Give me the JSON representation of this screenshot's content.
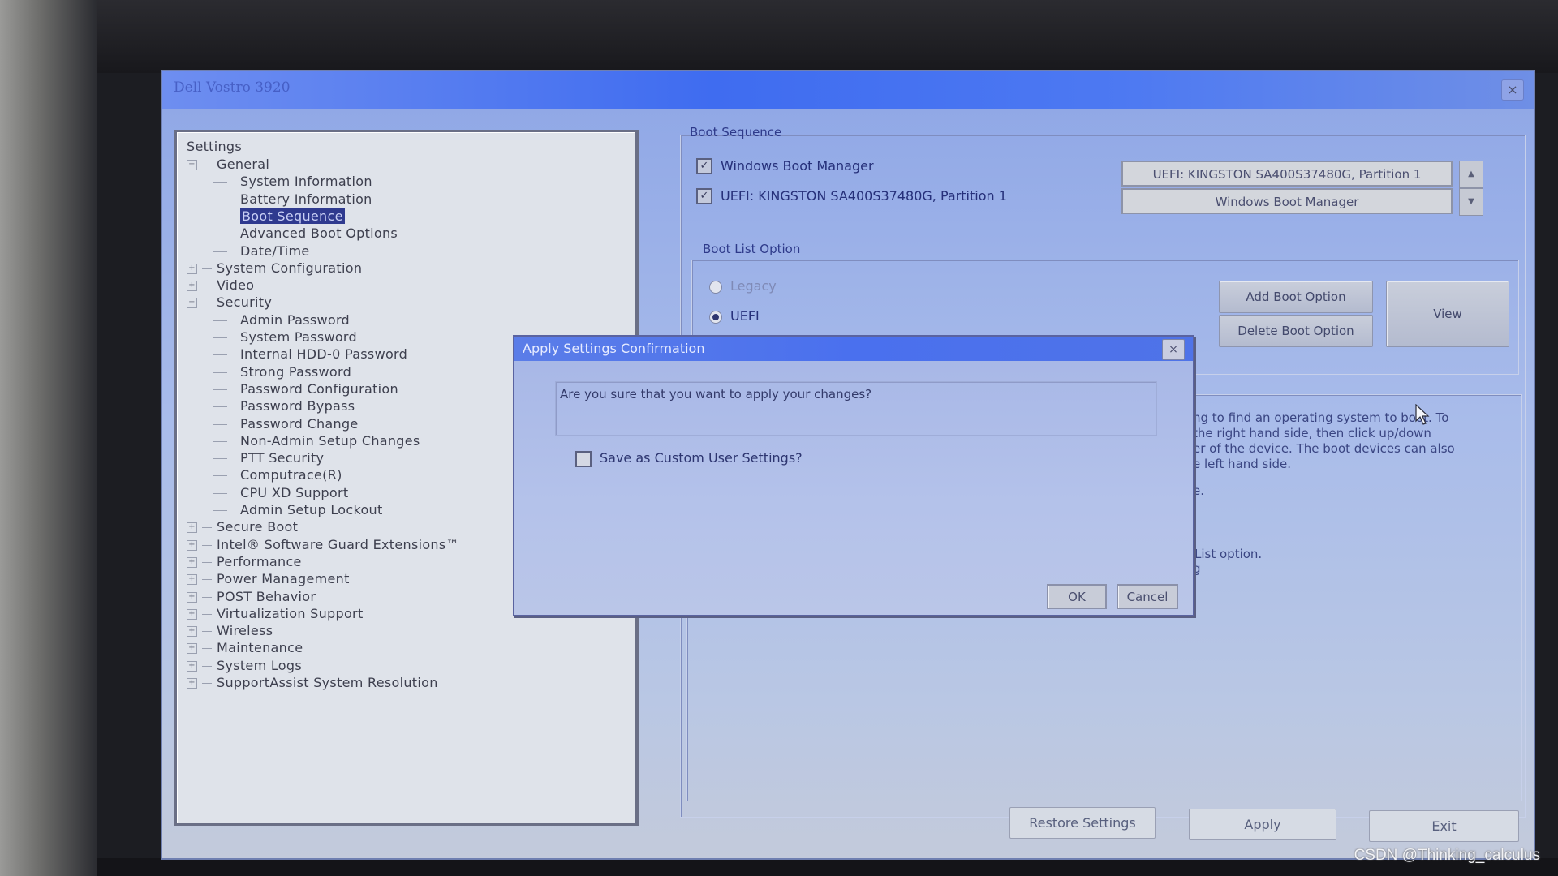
{
  "window": {
    "title": "Dell Vostro 3920",
    "close_icon": "×"
  },
  "tree": {
    "root": "Settings",
    "nodes": [
      {
        "label": "General",
        "level": 1,
        "expander": "−"
      },
      {
        "label": "System Information",
        "level": 2
      },
      {
        "label": "Battery Information",
        "level": 2
      },
      {
        "label": "Boot Sequence",
        "level": 2,
        "selected": true
      },
      {
        "label": "Advanced Boot Options",
        "level": 2
      },
      {
        "label": "Date/Time",
        "level": 2
      },
      {
        "label": "System Configuration",
        "level": 1,
        "expander": "+"
      },
      {
        "label": "Video",
        "level": 1,
        "expander": "+"
      },
      {
        "label": "Security",
        "level": 1,
        "expander": "−"
      },
      {
        "label": "Admin Password",
        "level": 2
      },
      {
        "label": "System Password",
        "level": 2
      },
      {
        "label": "Internal HDD-0 Password",
        "level": 2
      },
      {
        "label": "Strong Password",
        "level": 2
      },
      {
        "label": "Password Configuration",
        "level": 2
      },
      {
        "label": "Password Bypass",
        "level": 2
      },
      {
        "label": "Password Change",
        "level": 2
      },
      {
        "label": "Non-Admin Setup Changes",
        "level": 2
      },
      {
        "label": "PTT Security",
        "level": 2
      },
      {
        "label": "Computrace(R)",
        "level": 2
      },
      {
        "label": "CPU XD Support",
        "level": 2
      },
      {
        "label": "Admin Setup Lockout",
        "level": 2
      },
      {
        "label": "Secure Boot",
        "level": 1,
        "expander": "+"
      },
      {
        "label": "Intel® Software Guard Extensions™",
        "level": 1,
        "expander": "+"
      },
      {
        "label": "Performance",
        "level": 1,
        "expander": "+"
      },
      {
        "label": "Power Management",
        "level": 1,
        "expander": "+"
      },
      {
        "label": "POST Behavior",
        "level": 1,
        "expander": "+"
      },
      {
        "label": "Virtualization Support",
        "level": 1,
        "expander": "+"
      },
      {
        "label": "Wireless",
        "level": 1,
        "expander": "+"
      },
      {
        "label": "Maintenance",
        "level": 1,
        "expander": "+"
      },
      {
        "label": "System Logs",
        "level": 1,
        "expander": "+"
      },
      {
        "label": "SupportAssist System Resolution",
        "level": 1,
        "expander": "+"
      }
    ]
  },
  "boot_sequence": {
    "group_label": "Boot Sequence",
    "items": [
      {
        "label": "Windows Boot Manager",
        "checked": true
      },
      {
        "label": "UEFI: KINGSTON SA400S37480G, Partition 1",
        "checked": true
      }
    ],
    "order_list": [
      "UEFI: KINGSTON SA400S37480G, Partition 1",
      "Windows Boot Manager"
    ],
    "move_up_icon": "▲",
    "move_down_icon": "▼"
  },
  "boot_list_option": {
    "group_label": "Boot List Option",
    "options": [
      {
        "label": "Legacy",
        "selected": false,
        "disabled": true
      },
      {
        "label": "UEFI",
        "selected": true,
        "disabled": false
      }
    ],
    "add_button": "Add Boot Option",
    "delete_button": "Delete Boot Option",
    "view_button": "View"
  },
  "help_text": {
    "lines": [
      "ng to find an operating system to boot. To",
      "the right hand side, then click up/down",
      "er of the device. The boot devices can also",
      "e left hand side."
    ],
    "fragment_1": "e.",
    "fragment_2": "List option.",
    "fragment_3": "g"
  },
  "bottom_buttons": {
    "restore": "Restore Settings",
    "apply": "Apply",
    "exit": "Exit"
  },
  "dialog": {
    "title": "Apply Settings Confirmation",
    "close_icon": "×",
    "message": "Are you sure that you want to apply your changes?",
    "save_custom_label": "Save as Custom User Settings?",
    "save_custom_checked": false,
    "ok": "OK",
    "cancel": "Cancel"
  },
  "watermark": "CSDN @Thinking_calculus"
}
